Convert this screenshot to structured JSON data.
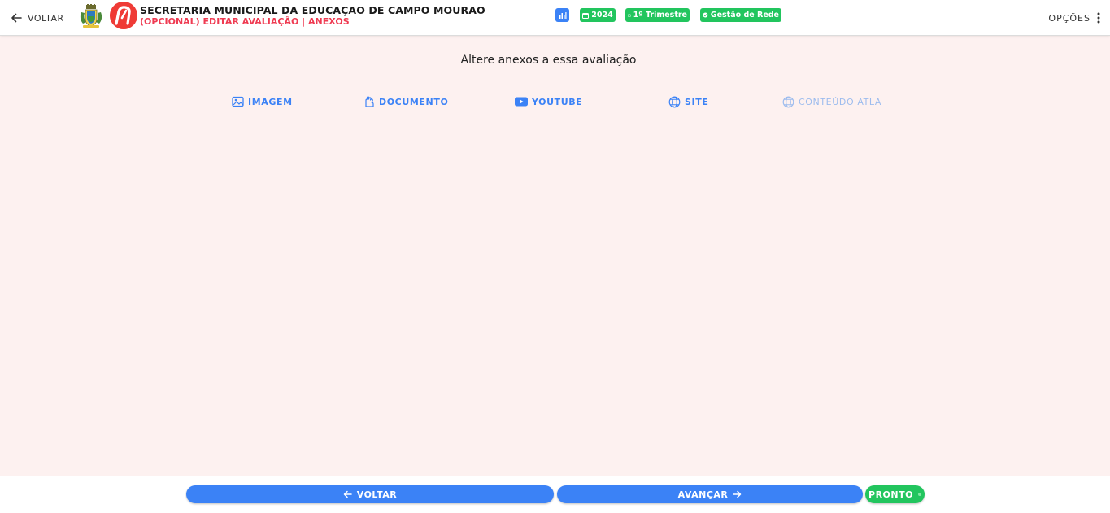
{
  "header": {
    "back_label": "VOLTAR",
    "title": "SECRETARIA MUNICIPAL DA EDUCAÇAO DE CAMPO MOURAO",
    "subtitle": "(OPCIONAL) EDITAR AVALIAÇÃO | ANEXOS",
    "chips": {
      "stats_icon": "bar-chart-icon",
      "year": "2024",
      "period": "1º Trimestre",
      "network": "Gestão de Rede"
    },
    "options_label": "OPÇÕES"
  },
  "main": {
    "prompt": "Altere anexos a essa avaliação",
    "tabs": [
      {
        "label": "IMAGEM",
        "icon": "image-icon",
        "enabled": true
      },
      {
        "label": "DOCUMENTO",
        "icon": "hand-document-icon",
        "enabled": true
      },
      {
        "label": "YOUTUBE",
        "icon": "youtube-icon",
        "enabled": true
      },
      {
        "label": "SITE",
        "icon": "globe-icon",
        "enabled": true
      },
      {
        "label": "CONTEÚDO ATLA",
        "icon": "globe-icon",
        "enabled": false
      }
    ]
  },
  "footer": {
    "back_label": "VOLTAR",
    "next_label": "AVANÇAR",
    "done_label": "PRONTO"
  },
  "colors": {
    "accent": "#3b82f6",
    "success": "#22c55e",
    "danger": "#ef3b52",
    "background": "#fdf1f0"
  }
}
